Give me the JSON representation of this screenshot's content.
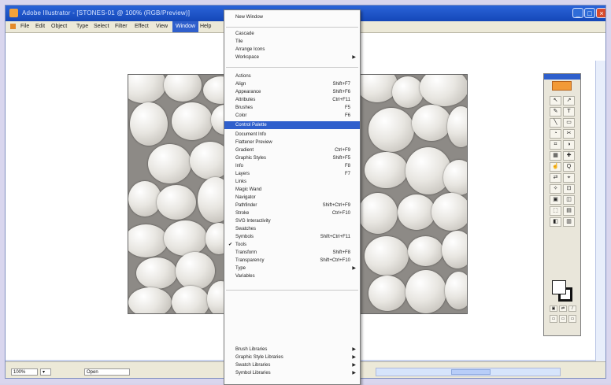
{
  "window": {
    "title": "Adobe Illustrator - [STONES-01 @ 100% (RGB/Preview)]",
    "controls": [
      "_",
      "□",
      "×"
    ]
  },
  "menubar": {
    "items": [
      "File",
      "Edit",
      "Object",
      "Type",
      "Select",
      "Filter",
      "Effect",
      "View",
      "Window",
      "Help"
    ],
    "active": "Window"
  },
  "window_menu": {
    "top_section": [
      "New Window"
    ],
    "arrange_section": [
      "Cascade",
      "Tile",
      "Arrange Icons",
      "Workspace"
    ],
    "panels": [
      {
        "label": "Actions",
        "shortcut": ""
      },
      {
        "label": "Align",
        "shortcut": "Shift+F7"
      },
      {
        "label": "Appearance",
        "shortcut": "Shift+F6"
      },
      {
        "label": "Attributes",
        "shortcut": "Ctrl+F11"
      },
      {
        "label": "Brushes",
        "shortcut": "F5"
      },
      {
        "label": "Color",
        "shortcut": "F6"
      },
      {
        "label": "Control Palette",
        "shortcut": ""
      },
      {
        "label": "Document Info",
        "shortcut": ""
      },
      {
        "label": "Flattener Preview",
        "shortcut": ""
      },
      {
        "label": "Gradient",
        "shortcut": "Ctrl+F9"
      },
      {
        "label": "Graphic Styles",
        "shortcut": "Shift+F5"
      },
      {
        "label": "Info",
        "shortcut": "F8"
      },
      {
        "label": "Layers",
        "shortcut": "F7"
      },
      {
        "label": "Links",
        "shortcut": ""
      },
      {
        "label": "Magic Wand",
        "shortcut": ""
      },
      {
        "label": "Navigator",
        "shortcut": ""
      },
      {
        "label": "Pathfinder",
        "shortcut": "Shift+Ctrl+F9"
      },
      {
        "label": "Stroke",
        "shortcut": "Ctrl+F10"
      },
      {
        "label": "SVG Interactivity",
        "shortcut": ""
      },
      {
        "label": "Swatches",
        "shortcut": ""
      },
      {
        "label": "Symbols",
        "shortcut": "Shift+Ctrl+F11"
      },
      {
        "label": "Tools",
        "shortcut": ""
      },
      {
        "label": "Transform",
        "shortcut": "Shift+F8"
      },
      {
        "label": "Transparency",
        "shortcut": "Shift+Ctrl+F10"
      },
      {
        "label": "Type",
        "shortcut": ""
      },
      {
        "label": "Variables",
        "shortcut": ""
      }
    ],
    "libraries": [
      "Brush Libraries",
      "Graphic Style Libraries",
      "Swatch Libraries",
      "Symbol Libraries"
    ],
    "highlighted": "Control Palette",
    "checked": "Tools"
  },
  "statusbar": {
    "zoom": "100%",
    "mode": "Open"
  },
  "toolbox": {
    "tools": [
      "↖",
      "↗",
      "✎",
      "T",
      "╲",
      "▭",
      "◔",
      "✂",
      "⌗",
      "◑",
      "▦",
      "✚",
      "☝",
      "Q",
      "⇄",
      "⌖",
      "✧",
      "⊡",
      "▣",
      "◫",
      "⬚",
      "▤",
      "◧",
      "▥"
    ]
  }
}
